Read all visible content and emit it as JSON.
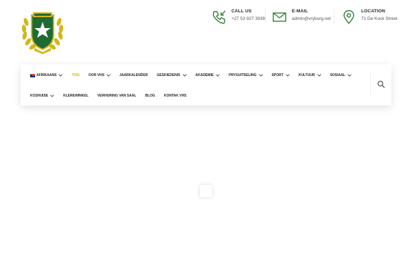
{
  "header": {
    "logo": {
      "name": "school-crest",
      "banner_text": "VRYBURG",
      "colors": {
        "green": "#1f6b33",
        "gold": "#d6b517"
      }
    },
    "contacts": [
      {
        "icon": "phone-incoming-icon",
        "label": "CALL US",
        "value": "+27 53 927 3938"
      },
      {
        "icon": "mail-icon",
        "label": "E-MAIL",
        "value": "admin@vryburg.net"
      },
      {
        "icon": "map-pin-icon",
        "label": "LOCATION",
        "value": "71 De Kock Street"
      }
    ],
    "icon_color": "#2e7d32"
  },
  "nav": {
    "row1": [
      {
        "label": "AFRIKAANS",
        "flag": true,
        "dropdown": true
      },
      {
        "label": "TUIS",
        "active": true,
        "dropdown": false
      },
      {
        "label": "OOR VHS",
        "dropdown": true
      },
      {
        "label": "JAARKALENDER",
        "dropdown": false
      },
      {
        "label": "GESKIEDENIS",
        "dropdown": true
      },
      {
        "label": "AKADEMIE",
        "dropdown": true
      },
      {
        "label": "PRYSUITDELING",
        "dropdown": true
      },
      {
        "label": "SPORT",
        "dropdown": true
      },
      {
        "label": "KULTUUR",
        "dropdown": true
      },
      {
        "label": "SOSIAAL",
        "dropdown": true
      }
    ],
    "row2": [
      {
        "label": "KOSHUISE",
        "dropdown": true
      },
      {
        "label": "KLEREWINKEL",
        "dropdown": false
      },
      {
        "label": "VERHURING VAN SAAL",
        "dropdown": false
      },
      {
        "label": "BLOG",
        "dropdown": false
      },
      {
        "label": "KONTAK VHS",
        "dropdown": false
      }
    ],
    "search_icon": "search-icon",
    "active_color": "#d4b400"
  }
}
